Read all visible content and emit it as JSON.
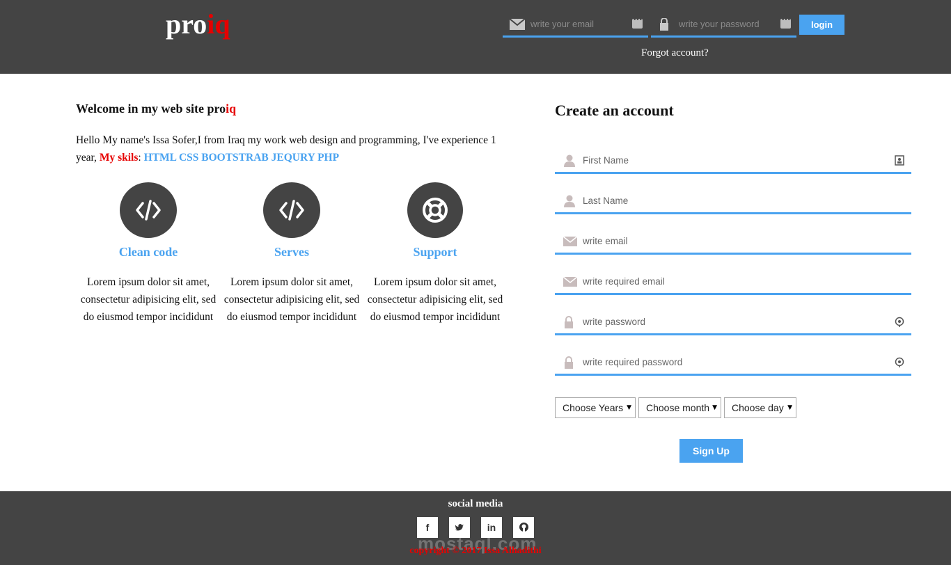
{
  "header": {
    "logo_main": "pro",
    "logo_accent": "iq",
    "email_placeholder": "write your email",
    "password_placeholder": "write your password",
    "login_label": "login",
    "forgot_label": "Forgot account?"
  },
  "intro": {
    "welcome_main": "Welcome in my web site pro",
    "welcome_accent": "iq",
    "text": "Hello My name's Issa Sofer,I from Iraq my work web design and programming, I've experience 1 year, ",
    "skills_label": "My skils",
    "skills_sep": ": ",
    "skills": "HTML CSS BOOTSTRAB JEQURY PHP"
  },
  "features": [
    {
      "title": "Clean code",
      "icon": "code-icon",
      "desc": "Lorem ipsum dolor sit amet, consectetur adipisicing elit, sed do eiusmod tempor incididunt"
    },
    {
      "title": "Serves",
      "icon": "code-icon",
      "desc": "Lorem ipsum dolor sit amet, consectetur adipisicing elit, sed do eiusmod tempor incididunt"
    },
    {
      "title": "Support",
      "icon": "lifebuoy-icon",
      "desc": "Lorem ipsum dolor sit amet, consectetur adipisicing elit, sed do eiusmod tempor incididunt"
    }
  ],
  "signup": {
    "title": "Create an account",
    "first_name": "First Name",
    "last_name": "Last Name",
    "email": "write email",
    "email_confirm": "write required email",
    "password": "write password",
    "password_confirm": "write required password",
    "year_select": "Choose Years",
    "month_select": "Choose month",
    "day_select": "Choose day",
    "submit_label": "Sign Up"
  },
  "footer": {
    "social_title": "social media",
    "social": [
      "f",
      "twitter",
      "in",
      "github"
    ],
    "copyright": "copyright © 2017 Issa Alhadithi",
    "watermark": "mostaql.com"
  },
  "colors": {
    "accent": "#4aa3f0",
    "brand_red": "#e60000",
    "dark": "#444444"
  }
}
